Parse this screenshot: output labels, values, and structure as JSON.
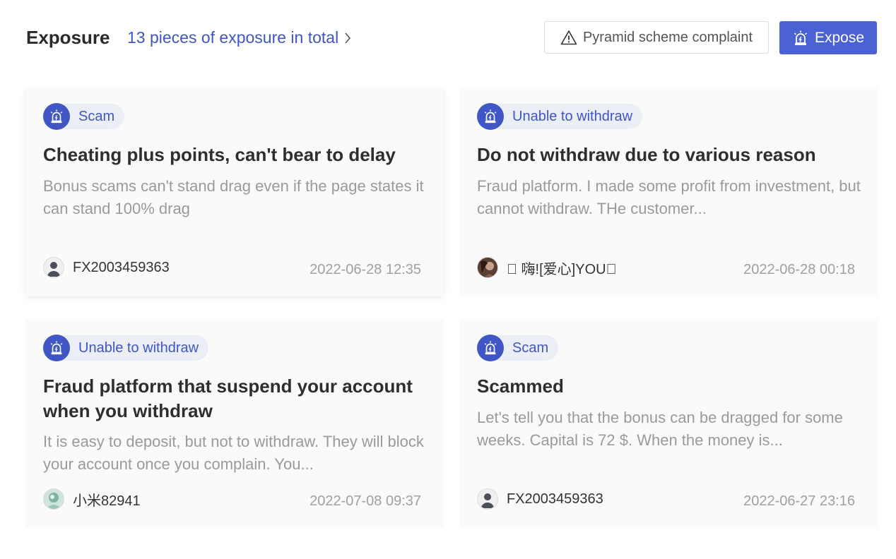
{
  "header": {
    "title": "Exposure",
    "total_link": "13 pieces of exposure in total",
    "complaint_button": "Pyramid scheme complaint",
    "expose_button": "Expose"
  },
  "colors": {
    "accent": "#4b62d4",
    "tag_text": "#3f56c4",
    "tag_bg": "#eceef5",
    "muted_text": "#9a9a9a"
  },
  "cards": [
    {
      "tag": "Scam",
      "title": "Cheating plus points, can't bear to delay",
      "description": "Bonus scams can't stand drag even if the page states it can stand 100% drag",
      "author": "FX2003459363",
      "date": "2022-06-28 12:35",
      "avatar": "default-user-avatar"
    },
    {
      "tag": "Unable to withdraw",
      "title": "Do not withdraw due to various reason",
      "description": "Fraud platform. I made some profit from investment, but cannot withdraw. THe customer...",
      "author": "\u0000 嗨![爱心]YOU\u0000",
      "date": "2022-06-28 00:18",
      "avatar": "photo-avatar"
    },
    {
      "tag": "Unable to withdraw",
      "title": "Fraud platform that suspend your account when you withdraw",
      "description": "It is easy to deposit, but not to withdraw. They will block your account once you complain. You...",
      "author": "小米82941",
      "date": "2022-07-08 09:37",
      "avatar": "photo-avatar"
    },
    {
      "tag": "Scam",
      "title": "Scammed",
      "description": "Let's tell you that the bonus can be dragged for some weeks. Capital is 72 $. When the money is...",
      "author": "FX2003459363",
      "date": "2022-06-27 23:16",
      "avatar": "default-user-avatar"
    }
  ]
}
